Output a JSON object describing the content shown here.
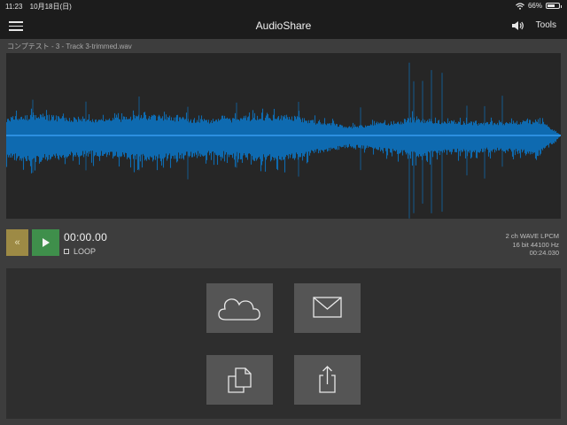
{
  "status_bar": {
    "time": "11:23",
    "date": "10月18日(日)",
    "battery_text": "66%",
    "battery_level": 0.66,
    "icons": [
      "wifi-icon",
      "battery-icon"
    ]
  },
  "nav": {
    "title": "AudioShare",
    "tools_label": "Tools",
    "icons": [
      "hamburger-menu-icon",
      "speaker-icon"
    ]
  },
  "file": {
    "name": "コンプテスト - 3 - Track 3-trimmed.wav"
  },
  "waveform": {
    "color": "#0f6bb0",
    "center_line_color": "#2c8fe0",
    "background": "#262626"
  },
  "transport": {
    "rewind_label": "«",
    "time": "00:00.00",
    "loop_label": "LOOP",
    "rewind_color": "#9d8a45",
    "play_color": "#3f8f4b"
  },
  "file_info": {
    "format": "2 ch WAVE LPCM",
    "bitrate": "16 bit 44100 Hz",
    "duration": "00:24.030"
  },
  "actions": [
    {
      "name": "cloud-upload-button",
      "icon": "cloud-icon"
    },
    {
      "name": "email-button",
      "icon": "envelope-icon"
    },
    {
      "name": "copy-button",
      "icon": "copy-icon"
    },
    {
      "name": "share-button",
      "icon": "share-icon"
    }
  ]
}
